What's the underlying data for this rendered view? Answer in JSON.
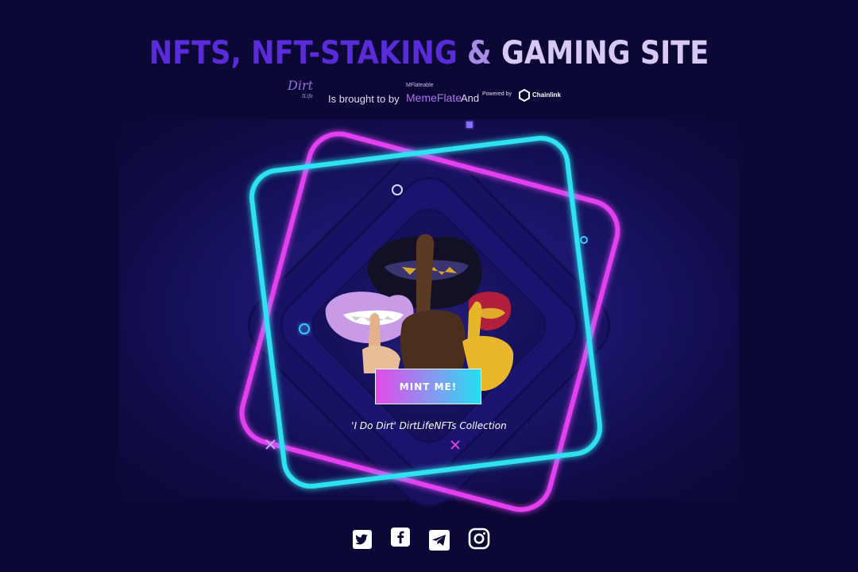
{
  "header": {
    "title_part1": "NFTS, NFT-STAKING",
    "title_part2": "&",
    "title_part3": "GAMING SITE"
  },
  "byline": {
    "dirt_logo_text": "Dirt",
    "dirt_logo_sub": "ILife",
    "brought_text": "Is brought to by",
    "memeflate_small": "MFlateable",
    "memeflate_name": "MemeFlate",
    "and_text": "And",
    "powered_text": "Powered by",
    "chainlink_name": "Chainlink"
  },
  "hero": {
    "mint_button_label": "MINT ME!",
    "collection_caption": "'I Do Dirt' DirtLifeNFTs Collection"
  },
  "social": {
    "icons": [
      "twitter-icon",
      "facebook-icon",
      "telegram-icon",
      "instagram-icon"
    ]
  },
  "colors": {
    "background": "#0c0836",
    "neon_magenta": "#e23ff0",
    "neon_cyan": "#2fe2f2",
    "title_purple": "#5a2bd8",
    "title_light": "#d7c8f5"
  }
}
